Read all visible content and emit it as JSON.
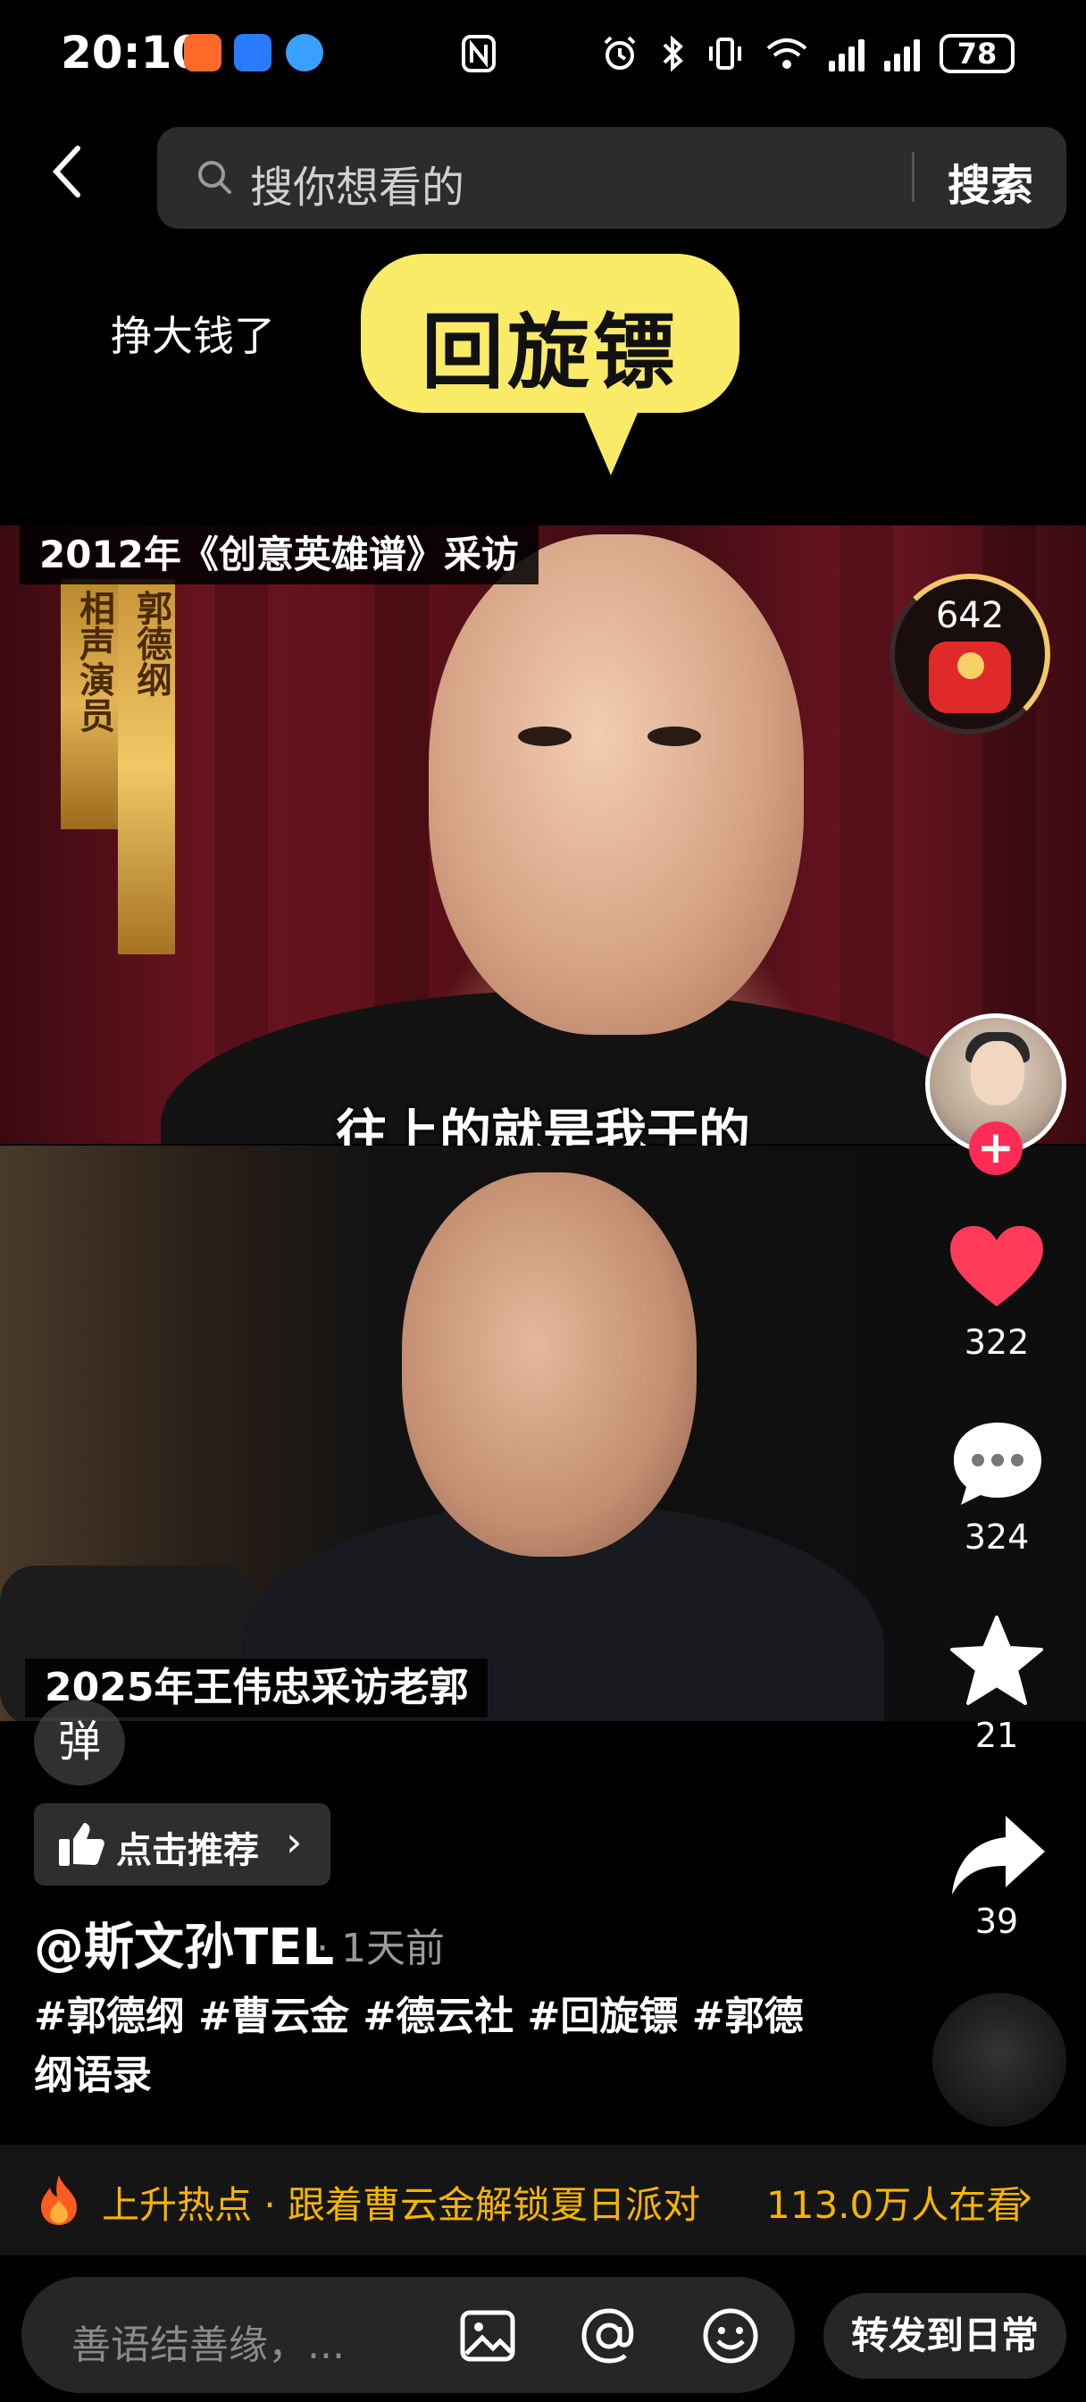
{
  "status_bar": {
    "time": "20:10",
    "battery": "78"
  },
  "search": {
    "placeholder": "搜你想看的",
    "button": "搜索"
  },
  "overlay": {
    "earn_text": "挣大钱了",
    "bubble_text": "回旋镖"
  },
  "video": {
    "label_top": "2012年《创意英雄谱》采访",
    "plaque_name": "郭德纲",
    "plaque_title": "相声演员",
    "subtitle": "往上的就是我干的",
    "label_bottom": "2025年王伟忠采访老郭"
  },
  "rail": {
    "red_packet_count": "642",
    "likes": "322",
    "comments": "324",
    "favorites": "21",
    "shares": "39",
    "follow_symbol": "+"
  },
  "info": {
    "danmu": "弹",
    "recommend": "点击推荐",
    "author": "@斯文孙TEL",
    "time_ago": "· 1天前",
    "tags": "#郭德纲 #曹云金 #德云社 #回旋镖 #郭德纲语录"
  },
  "hot": {
    "label": "上升热点 · 跟着曹云金解锁夏日派对",
    "viewers": "113.0万人在看"
  },
  "comment": {
    "placeholder": "善语结善缘，...",
    "forward": "转发到日常"
  },
  "colors": {
    "accent_pink": "#fe2c55",
    "like_red": "#fe3c5a",
    "hot_yellow": "#f7b500",
    "bubble_yellow": "#f9ea68"
  }
}
